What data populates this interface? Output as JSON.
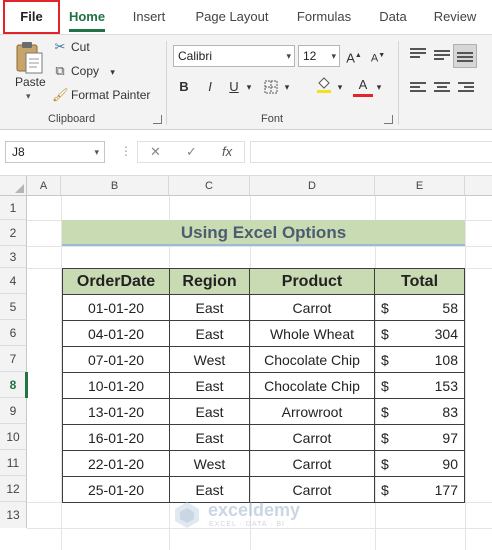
{
  "tabs": [
    "File",
    "Home",
    "Insert",
    "Page Layout",
    "Formulas",
    "Data",
    "Review"
  ],
  "clipboard": {
    "paste_label": "Paste",
    "cut_label": "Cut",
    "copy_label": "Copy",
    "format_painter_label": "Format Painter",
    "group_label": "Clipboard"
  },
  "font": {
    "name": "Calibri",
    "size": "12",
    "group_label": "Font",
    "bold": "B",
    "italic": "I",
    "underline": "U",
    "grow": "A",
    "shrink": "A",
    "font_color_letter": "A"
  },
  "formula_bar": {
    "name_box": "J8",
    "cancel": "✕",
    "enter": "✓",
    "fx": "fx",
    "formula": ""
  },
  "columns": [
    "A",
    "B",
    "C",
    "D",
    "E"
  ],
  "rows": [
    "1",
    "2",
    "3",
    "4",
    "5",
    "6",
    "7",
    "8",
    "9",
    "10",
    "11",
    "12",
    "13"
  ],
  "sheet": {
    "title": "Using Excel Options",
    "headers": [
      "OrderDate",
      "Region",
      "Product",
      "Total"
    ],
    "records": [
      {
        "date": "01-01-20",
        "region": "East",
        "product": "Carrot",
        "currency": "$",
        "total": "58"
      },
      {
        "date": "04-01-20",
        "region": "East",
        "product": "Whole Wheat",
        "currency": "$",
        "total": "304"
      },
      {
        "date": "07-01-20",
        "region": "West",
        "product": "Chocolate Chip",
        "currency": "$",
        "total": "108"
      },
      {
        "date": "10-01-20",
        "region": "East",
        "product": "Chocolate Chip",
        "currency": "$",
        "total": "153"
      },
      {
        "date": "13-01-20",
        "region": "East",
        "product": "Arrowroot",
        "currency": "$",
        "total": "83"
      },
      {
        "date": "16-01-20",
        "region": "East",
        "product": "Carrot",
        "currency": "$",
        "total": "97"
      },
      {
        "date": "22-01-20",
        "region": "West",
        "product": "Carrot",
        "currency": "$",
        "total": "90"
      },
      {
        "date": "25-01-20",
        "region": "East",
        "product": "Carrot",
        "currency": "$",
        "total": "177"
      }
    ]
  },
  "watermark": {
    "name": "exceldemy",
    "tagline": "EXCEL · DATA · BI"
  },
  "colors": {
    "accent": "#217346",
    "file_highlight": "#e3232a",
    "header_fill": "#c9dbb3",
    "title_text": "#4b5d6e"
  }
}
